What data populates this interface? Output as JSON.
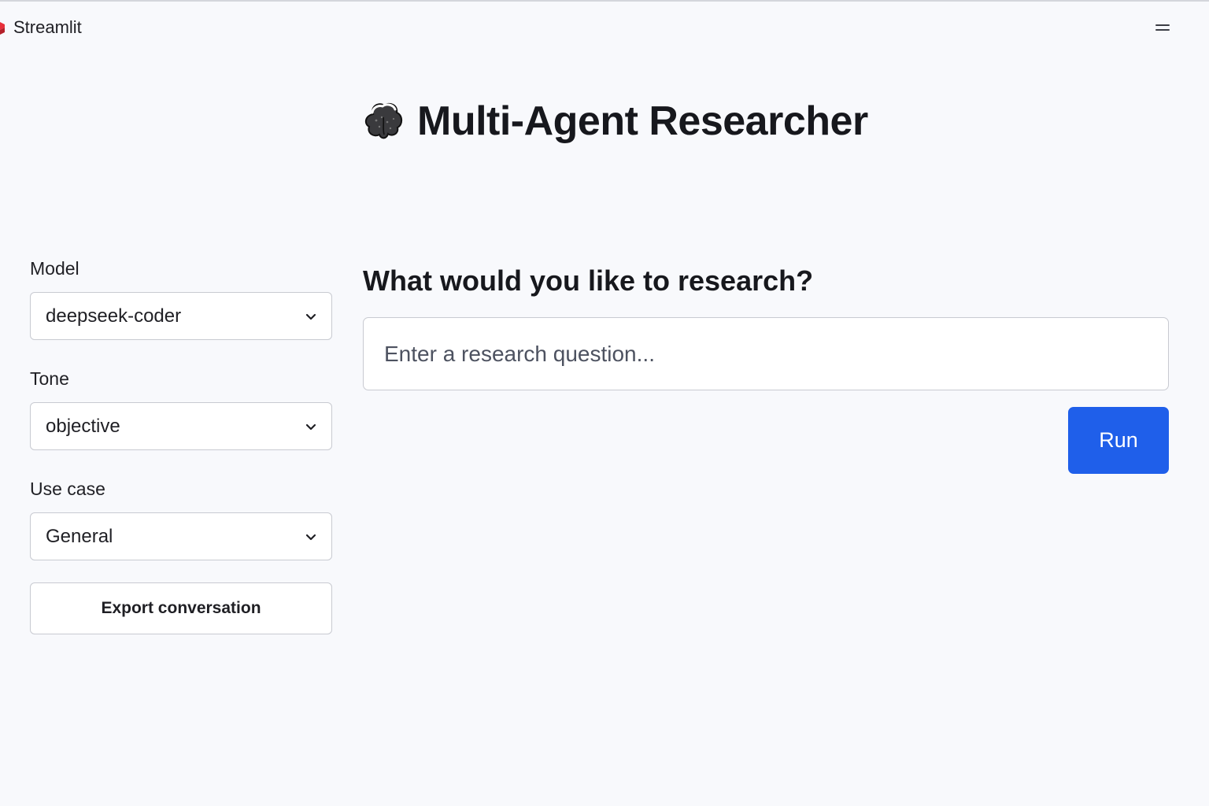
{
  "header": {
    "app_name": "Streamlit",
    "menu_icon": "hamburger-menu-icon"
  },
  "page": {
    "title": "Multi-Agent Researcher",
    "title_icon": "brain-icon"
  },
  "sidebar": {
    "fields": [
      {
        "label": "Model",
        "value": "deepseek-coder"
      },
      {
        "label": "Tone",
        "value": "objective"
      },
      {
        "label": "Use case",
        "value": "General"
      }
    ],
    "export_label": "Export conversation"
  },
  "main": {
    "heading": "What would you like to research?",
    "query": {
      "value": "",
      "placeholder": "Enter a research question..."
    },
    "run_label": "Run"
  },
  "colors": {
    "background": "#f8f9fc",
    "primary": "#1f5fea",
    "brand_red": "#e8303b"
  }
}
